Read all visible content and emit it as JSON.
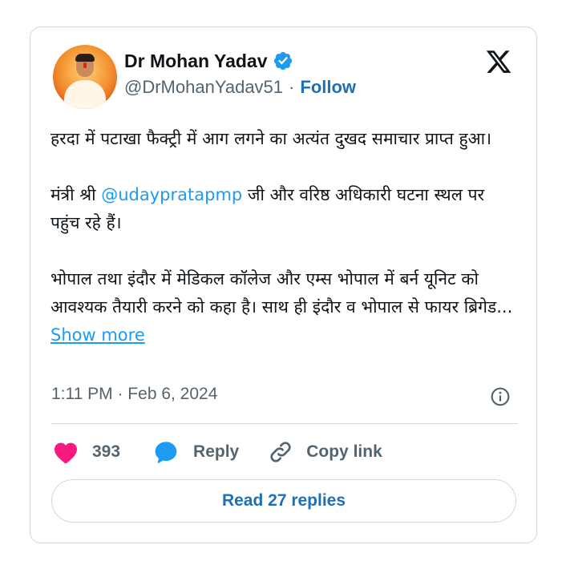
{
  "author": {
    "name": "Dr Mohan Yadav",
    "handle": "@DrMohanYadav51",
    "separator": "·",
    "follow_label": "Follow",
    "verified": true
  },
  "tweet": {
    "para1": "हरदा में पटाखा फैक्ट्री में आग लगने का अत्यंत दुखद समाचार प्राप्त हुआ।",
    "para2_before": "मंत्री श्री ",
    "para2_mention": "@udaypratapmp",
    "para2_after": " जी और वरिष्ठ अधिकारी घटना स्थल पर पहुंच रहे हैं।",
    "para3": "भोपाल तथा इंदौर में मेडिकल कॉलेज और एम्स भोपाल में बर्न यूनिट को आवश्यक तैयारी करने को कहा है। साथ ही इंदौर व भोपाल से फायर ब्रिगेड...",
    "show_more": " Show more",
    "timestamp": "1:11 PM · Feb 6, 2024"
  },
  "actions": {
    "like_count": "393",
    "reply_label": "Reply",
    "copy_label": "Copy link"
  },
  "read_replies_label": "Read 27 replies",
  "colors": {
    "link_blue": "#1d9bf0",
    "follow_blue": "#1d6fb8",
    "like_pink": "#f91880",
    "reply_blue": "#1d9bf0",
    "muted": "#536471",
    "border": "#cfd9de"
  },
  "icons": [
    "x-logo-icon",
    "verified-badge-icon",
    "info-icon",
    "heart-icon",
    "reply-bubble-icon",
    "link-icon"
  ]
}
